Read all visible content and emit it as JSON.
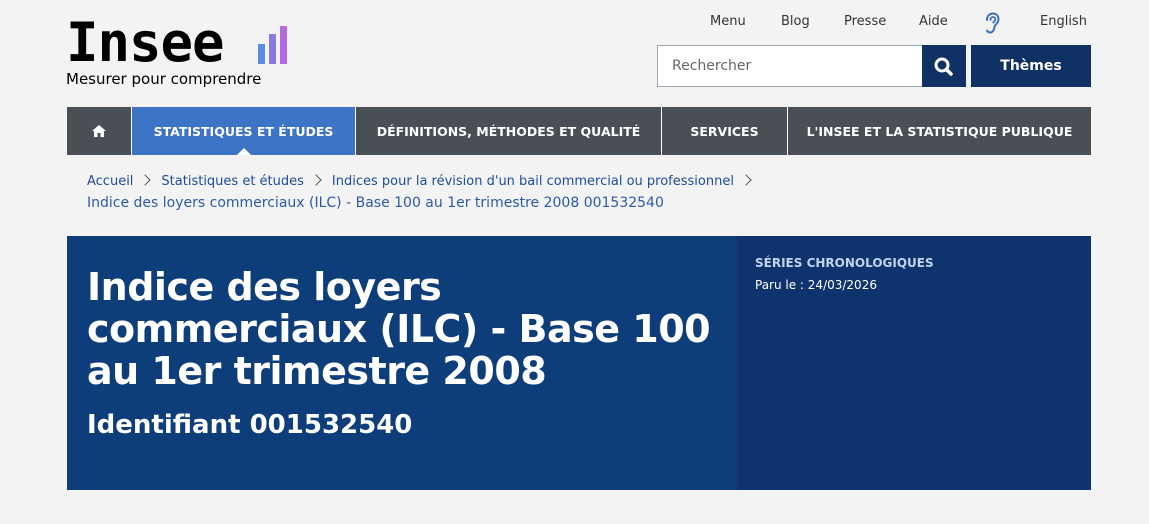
{
  "logo": {
    "word": "Insee",
    "tagline": "Mesurer pour comprendre",
    "bar_colors": [
      "#5b8de3",
      "#8b78e0",
      "#b06be0"
    ]
  },
  "top_links": [
    {
      "label": "Menu"
    },
    {
      "label": "Blog"
    },
    {
      "label": "Presse"
    },
    {
      "label": "Aide"
    },
    {
      "label": "English"
    }
  ],
  "accessibility_icon": "ear-icon",
  "search": {
    "placeholder": "Rechercher",
    "value": "",
    "button_icon": "search-icon"
  },
  "themes_button": "Thèmes",
  "nav": {
    "home_icon": "home-icon",
    "items": [
      {
        "label": "STATISTIQUES ET ÉTUDES",
        "active": true
      },
      {
        "label": "DÉFINITIONS, MÉTHODES ET QUALITÉ",
        "active": false
      },
      {
        "label": "SERVICES",
        "active": false
      },
      {
        "label": "L'INSEE ET LA STATISTIQUE PUBLIQUE",
        "active": false
      }
    ]
  },
  "breadcrumb": {
    "items": [
      "Accueil",
      "Statistiques et études",
      "Indices pour la révision d'un bail commercial ou professionnel"
    ],
    "current": "Indice des loyers commerciaux (ILC) - Base 100 au 1er trimestre 2008 001532540"
  },
  "hero": {
    "title": "Indice des loyers commerciaux (ILC) - Base 100 au 1er trimestre 2008",
    "identifier": "Identifiant 001532540",
    "type": "SÉRIES CHRONOLOGIQUES",
    "published": "Paru le : 24/03/2026"
  },
  "colors": {
    "primary_dark": "#103163",
    "nav_bg": "#4a4f55",
    "nav_active": "#3e74c6",
    "hero_bg": "#0d3e7a",
    "hero_side": "#0f346d",
    "link": "#1f4c99"
  }
}
